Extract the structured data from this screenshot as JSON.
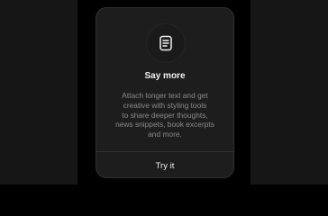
{
  "card": {
    "icon": "document-icon",
    "title": "Say more",
    "description": "Attach longer text and get\ncreative with styling tools\nto share deeper thoughts,\nnews snippets, book excerpts\nand more.",
    "cta_label": "Try it"
  },
  "colors": {
    "background": "#000000",
    "card_background": "#1d1d1d",
    "title_text": "#f2f2f2",
    "body_text": "#8a8a8a",
    "divider": "#333333"
  }
}
